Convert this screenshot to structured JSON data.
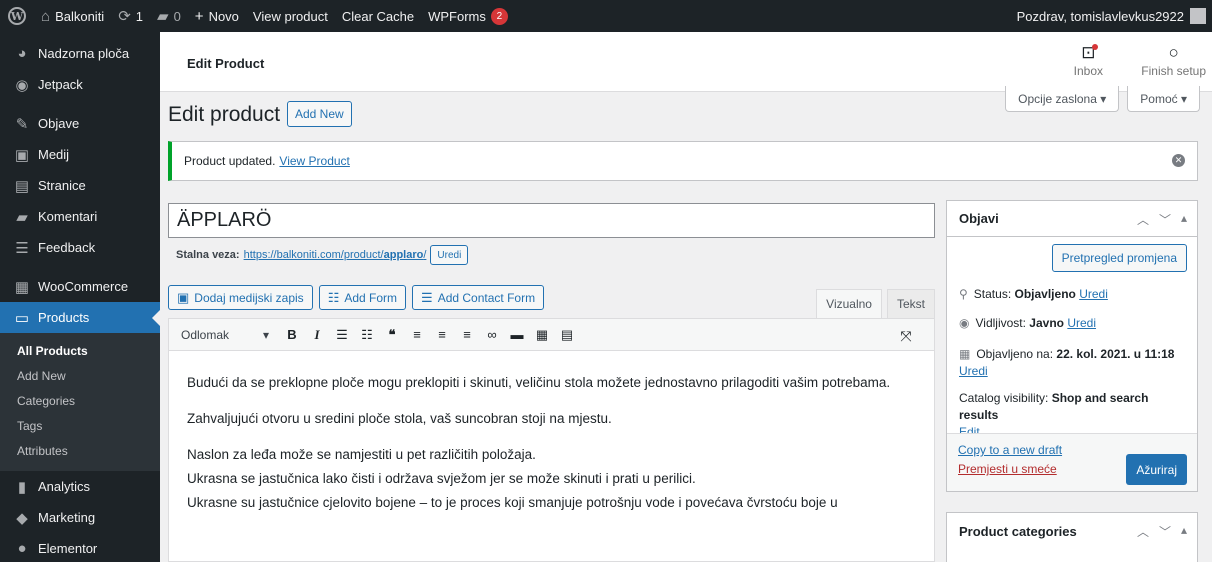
{
  "adminbar": {
    "site": "Balkoniti",
    "updates": "1",
    "comments": "0",
    "new": "Novo",
    "view_product": "View product",
    "clear_cache": "Clear Cache",
    "wpforms": "WPForms",
    "wpforms_count": "2",
    "greeting": "Pozdrav, tomislavlevkus2922"
  },
  "sidebar": {
    "items": [
      {
        "label": "Nadzorna ploča",
        "icon": "dashboard-icon"
      },
      {
        "label": "Jetpack",
        "icon": "jetpack-icon"
      },
      {
        "label": "Objave",
        "icon": "pin-icon"
      },
      {
        "label": "Medij",
        "icon": "media-icon"
      },
      {
        "label": "Stranice",
        "icon": "page-icon"
      },
      {
        "label": "Komentari",
        "icon": "comment-icon"
      },
      {
        "label": "Feedback",
        "icon": "feedback-icon"
      },
      {
        "label": "WooCommerce",
        "icon": "woo-icon"
      },
      {
        "label": "Products",
        "icon": "products-icon"
      },
      {
        "label": "Analytics",
        "icon": "analytics-icon"
      },
      {
        "label": "Marketing",
        "icon": "megaphone-icon"
      },
      {
        "label": "Elementor",
        "icon": "elementor-icon"
      }
    ],
    "submenu": [
      "All Products",
      "Add New",
      "Categories",
      "Tags",
      "Attributes"
    ]
  },
  "header": {
    "title": "Edit Product",
    "inbox": "Inbox",
    "finish_setup": "Finish setup"
  },
  "screen_options": "Opcije zaslona",
  "help": "Pomoć",
  "page": {
    "heading": "Edit product",
    "add_new": "Add New"
  },
  "notice": {
    "text": "Product updated.",
    "link": "View Product"
  },
  "product": {
    "title": "ÄPPLARÖ",
    "permalink_label": "Stalna veza:",
    "permalink_base": "https://balkoniti.com/product/",
    "permalink_slug": "applaro",
    "permalink_end": "/",
    "edit": "Uredi"
  },
  "editor": {
    "add_media": "Dodaj medijski zapis",
    "add_form": "Add Form",
    "add_contact_form": "Add Contact Form",
    "tab_visual": "Vizualno",
    "tab_text": "Tekst",
    "format": "Odlomak",
    "paragraphs": [
      "Budući da se preklopne ploče mogu preklopiti i skinuti, veličinu stola možete jednostavno prilagoditi vašim potrebama.",
      "Zahvaljujući otvoru u sredini ploče stola, vaš suncobran stoji na mjestu."
    ],
    "lines": [
      "Naslon za leđa može se namjestiti u pet različitih položaja.",
      "Ukrasna se jastučnica lako čisti i održava svježom jer se može skinuti i prati u perilici.",
      "Ukrasne su jastučnice cjelovito bojene – to je proces koji smanjuje potrošnju vode i povećava čvrstoću boje u"
    ]
  },
  "publish": {
    "title": "Objavi",
    "preview": "Pretpregled promjena",
    "status_label": "Status:",
    "status_value": "Objavljeno",
    "visibility_label": "Vidljivost:",
    "visibility_value": "Javno",
    "published_label": "Objavljeno na:",
    "published_value": "22. kol. 2021. u 11:18",
    "catalog_label": "Catalog visibility:",
    "catalog_value": "Shop and search results",
    "catalog_edit": "Edit",
    "edit": "Uredi",
    "copy_draft": "Copy to a new draft",
    "trash": "Premjesti u smeće",
    "update": "Ažuriraj"
  },
  "categories": {
    "title": "Product categories"
  }
}
